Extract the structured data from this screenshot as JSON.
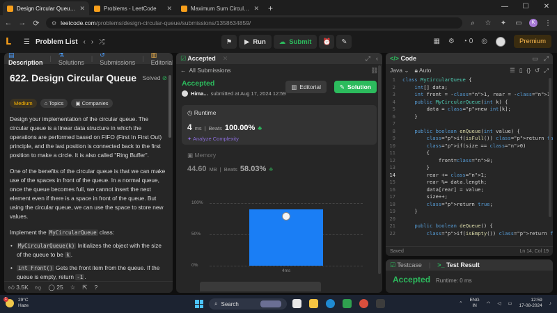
{
  "browser": {
    "tabs": [
      {
        "title": "Design Circular Queue - LeetC",
        "active": true
      },
      {
        "title": "Problems - LeetCode",
        "active": false
      },
      {
        "title": "Maximum Sum Circular Subar",
        "active": false
      }
    ],
    "url_host": "leetcode.com",
    "url_path": "/problems/design-circular-queue/submissions/1358634859/",
    "profile_initial": "K"
  },
  "header": {
    "problem_list": "Problem List",
    "run": "Run",
    "submit": "Submit",
    "streak": "0",
    "premium": "Premium"
  },
  "left": {
    "tabs": [
      "Description",
      "Solutions",
      "Submissions",
      "Editorial"
    ],
    "title": "622. Design Circular Queue",
    "solved": "Solved",
    "tags": [
      "Medium",
      "Topics",
      "Companies"
    ],
    "p1": "Design your implementation of the circular queue. The circular queue is a linear data structure in which the operations are performed based on FIFO (First In First Out) principle, and the last position is connected back to the first position to make a circle. It is also called \"Ring Buffer\".",
    "p2": "One of the benefits of the circular queue is that we can make use of the spaces in front of the queue. In a normal queue, once the queue becomes full, we cannot insert the next element even if there is a space in front of the queue. But using the circular queue, we can use the space to store new values.",
    "p3_pre": "Implement the ",
    "p3_code": "MyCircularQueue",
    "p3_post": " class:",
    "b1_code": "MyCircularQueue(k)",
    "b1_pre": " Initializes the object with the size of the queue to be ",
    "b1_k": "k",
    "b1_post": ".",
    "b2_code": "int Front()",
    "b2_pre": " Gets the front item from the queue. If the queue is empty, return ",
    "b2_ret": "-1",
    "b2_post": ".",
    "likes": "3.5K",
    "comments": "25"
  },
  "mid": {
    "tab": "Accepted",
    "all_submissions": "All Submissions",
    "status": "Accepted",
    "user": "Hima...",
    "submitted": "submitted at Aug 17, 2024 12:59",
    "editorial": "Editorial",
    "solution": "Solution",
    "runtime_label": "Runtime",
    "runtime_value": "4",
    "runtime_unit": "ms",
    "beats_label": "Beats",
    "runtime_beats": "100.00%",
    "analyze": "Analyze Complexity",
    "memory_label": "Memory",
    "memory_value": "44.60",
    "memory_unit": "MB",
    "memory_beats": "58.03%"
  },
  "chart_data": {
    "type": "bar",
    "categories": [
      "4ms"
    ],
    "values": [
      90
    ],
    "ylim": [
      0,
      100
    ],
    "yticks": [
      "100%",
      "50%",
      "0%"
    ]
  },
  "right": {
    "tab": "Code",
    "language": "Java",
    "mode": "Auto",
    "lines": [
      {
        "n": "1",
        "t": "class MyCircularQueue {"
      },
      {
        "n": "2",
        "t": "    int[] data;"
      },
      {
        "n": "3",
        "t": "    int front = -1, rear = -1 , size = 0;"
      },
      {
        "n": "4",
        "t": "    public MyCircularQueue(int k) {"
      },
      {
        "n": "5",
        "t": "        data = new int[k];"
      },
      {
        "n": "6",
        "t": "    }"
      },
      {
        "n": "7",
        "t": ""
      },
      {
        "n": "8",
        "t": "    public boolean enQueue(int value) {"
      },
      {
        "n": "9",
        "t": "        if(isFull()) return false;"
      },
      {
        "n": "10",
        "t": "        if(size == 0)"
      },
      {
        "n": "11",
        "t": "        {"
      },
      {
        "n": "12",
        "t": "            front=0;"
      },
      {
        "n": "13",
        "t": "        }"
      },
      {
        "n": "14",
        "t": "        rear += 1;"
      },
      {
        "n": "15",
        "t": "        rear %= data.length;"
      },
      {
        "n": "16",
        "t": "        data[rear] = value;"
      },
      {
        "n": "17",
        "t": "        size++;"
      },
      {
        "n": "18",
        "t": "        return true;"
      },
      {
        "n": "19",
        "t": "    }"
      },
      {
        "n": "20",
        "t": ""
      },
      {
        "n": "21",
        "t": "    public boolean deQueue() {"
      },
      {
        "n": "22",
        "t": "        if(isEmpty()) return false;"
      }
    ],
    "saved": "Saved",
    "cursor": "Ln 14, Col 19"
  },
  "testpanel": {
    "tab1": "Testcase",
    "tab2": "Test Result",
    "status": "Accepted",
    "runtime": "Runtime: 0 ms"
  },
  "taskbar": {
    "temp": "29°C",
    "weather": "Haze",
    "search": "Search",
    "lang1": "ENG",
    "lang2": "IN",
    "time": "12:59",
    "date": "17-08-2024",
    "badge": "1"
  }
}
